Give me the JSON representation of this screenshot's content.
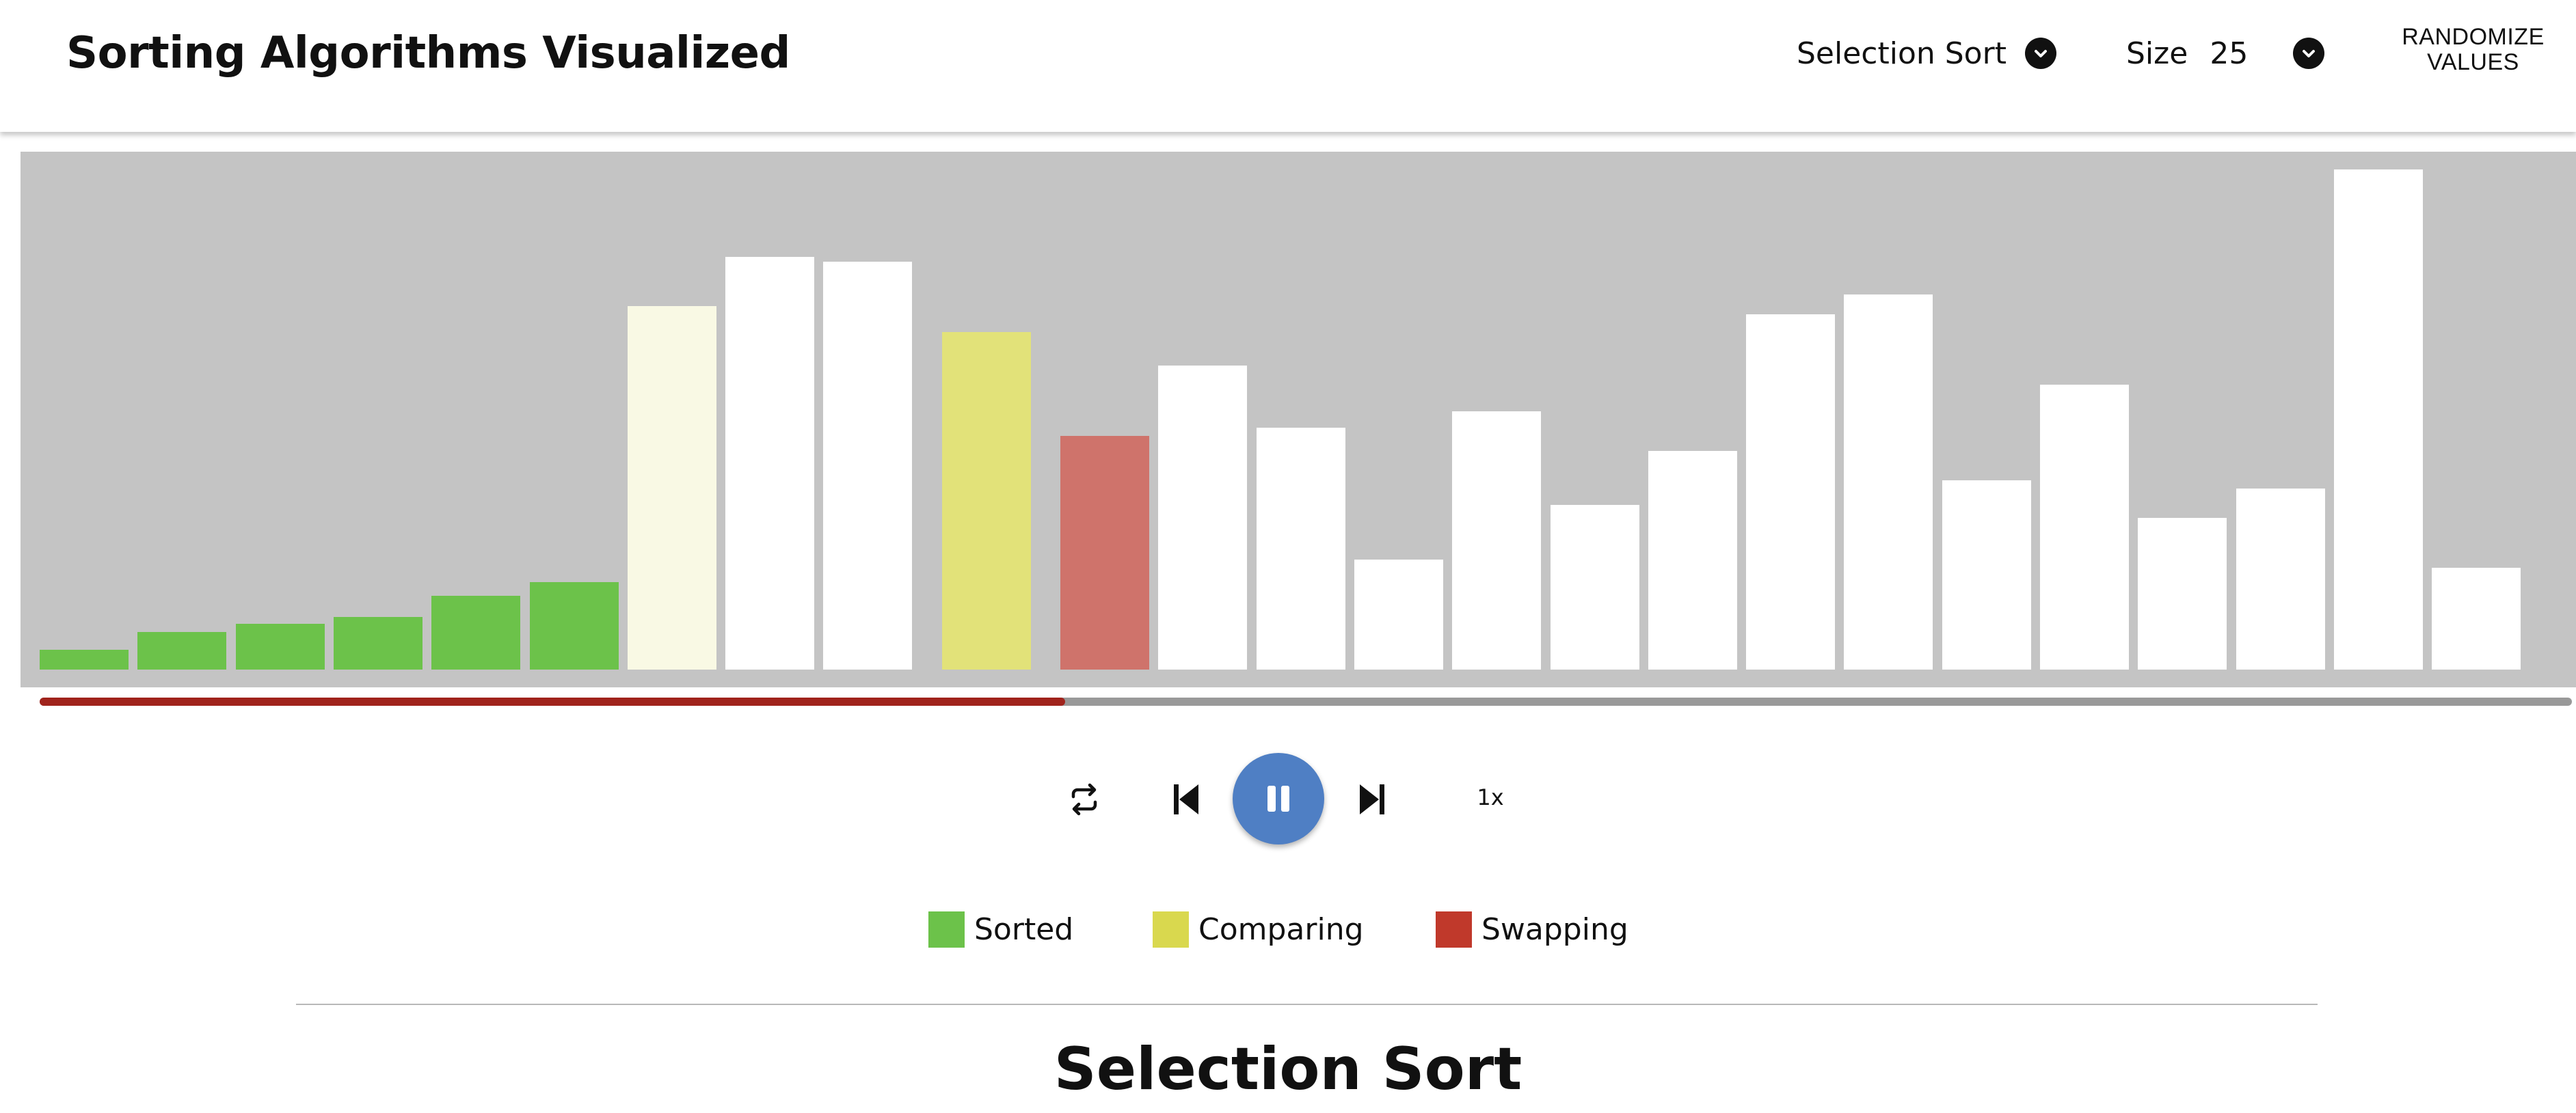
{
  "header": {
    "title": "Sorting Algorithms Visualized",
    "algorithm_select": {
      "value": "Selection Sort",
      "icon": "chevron-down-icon"
    },
    "size_select": {
      "label": "Size",
      "value": "25",
      "icon": "chevron-down-icon"
    },
    "randomize_label_line1": "RANDOMIZE",
    "randomize_label_line2": "VALUES"
  },
  "colors": {
    "sorted": "#6cc24a",
    "comparing": "#e2e279",
    "swapping": "#cf736b",
    "current": "#f9f9e4",
    "unsorted": "#ffffff",
    "chart_background": "#c4c4c4",
    "progress_fill": "#a0231c",
    "progress_track": "#999999",
    "play_button": "#4f7fc4"
  },
  "array": {
    "values": [
      12,
      23,
      28,
      32,
      45,
      53,
      221,
      251,
      248,
      205,
      142,
      185,
      147,
      67,
      157,
      100,
      133,
      216,
      228,
      115,
      173,
      92,
      110,
      304,
      62
    ],
    "states": [
      "sorted",
      "sorted",
      "sorted",
      "sorted",
      "sorted",
      "sorted",
      "current",
      "unsorted",
      "unsorted",
      "comparing",
      "swapping",
      "unsorted",
      "unsorted",
      "unsorted",
      "unsorted",
      "unsorted",
      "unsorted",
      "unsorted",
      "unsorted",
      "unsorted",
      "unsorted",
      "unsorted",
      "unsorted",
      "unsorted",
      "unsorted"
    ]
  },
  "progress": {
    "fraction": 0.405
  },
  "playback": {
    "repeat_icon": "repeat-icon",
    "step_back_icon": "step-back-icon",
    "pause_icon": "pause-icon",
    "step_forward_icon": "step-forward-icon",
    "speed": "1x"
  },
  "legend": [
    {
      "label": "Sorted",
      "color": "#6cc24a"
    },
    {
      "label": "Comparing",
      "color": "#d9d84e"
    },
    {
      "label": "Swapping",
      "color": "#c0392b"
    }
  ],
  "section": {
    "title": "Selection Sort"
  }
}
